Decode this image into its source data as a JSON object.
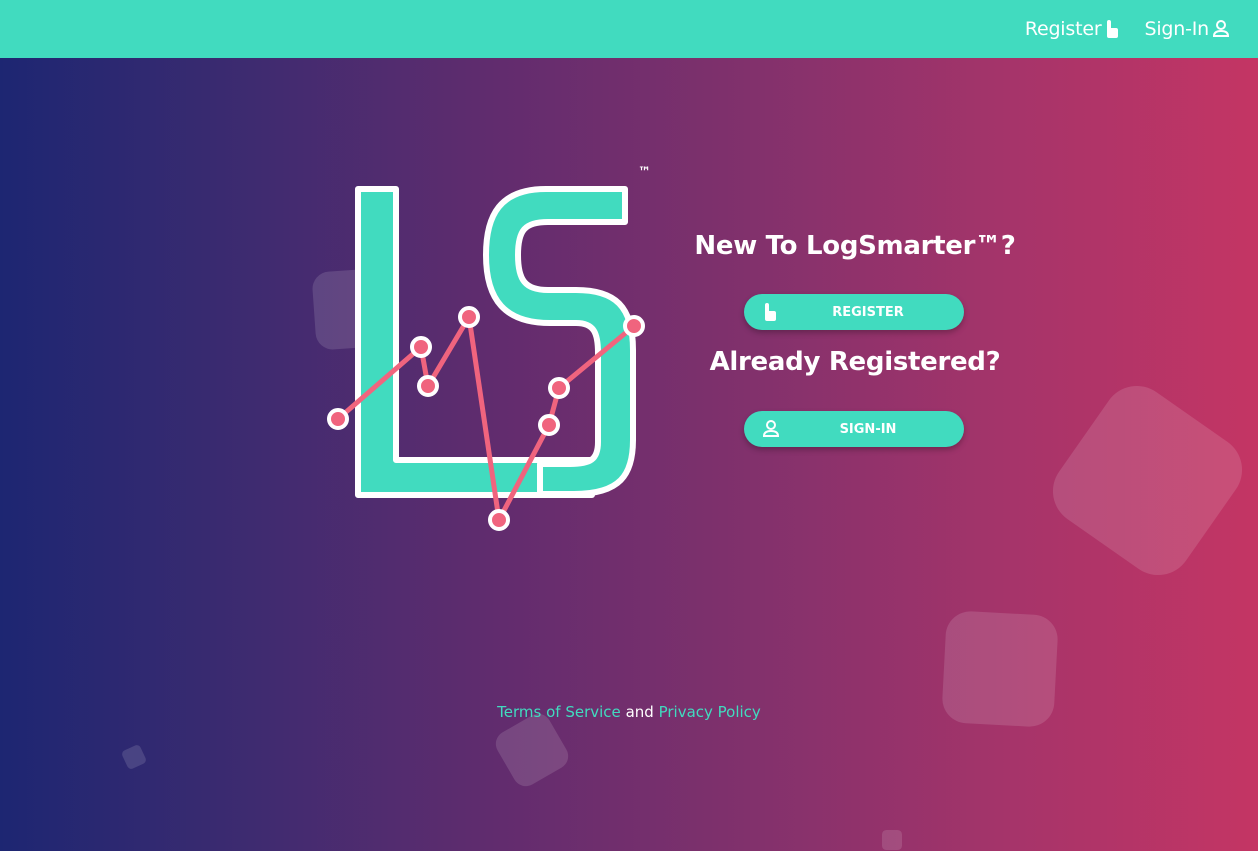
{
  "nav": {
    "register_label": "Register",
    "register_icon": "pointer-hand-icon",
    "signin_label": "Sign-In",
    "signin_icon": "user-icon"
  },
  "logo": {
    "letters": "LS",
    "trademark": "™"
  },
  "cta": {
    "new_heading": "New To LogSmarter™?",
    "register_button": "REGISTER",
    "existing_heading": "Already Registered?",
    "signin_button": "SIGN-IN"
  },
  "footer": {
    "terms_label": "Terms of Service",
    "conjunction": "and",
    "privacy_label": "Privacy Policy"
  },
  "colors": {
    "brand_teal": "#41dbbf",
    "accent_pink": "#f0647e",
    "gradient_left": "#1d2672",
    "gradient_right": "#c43564"
  }
}
